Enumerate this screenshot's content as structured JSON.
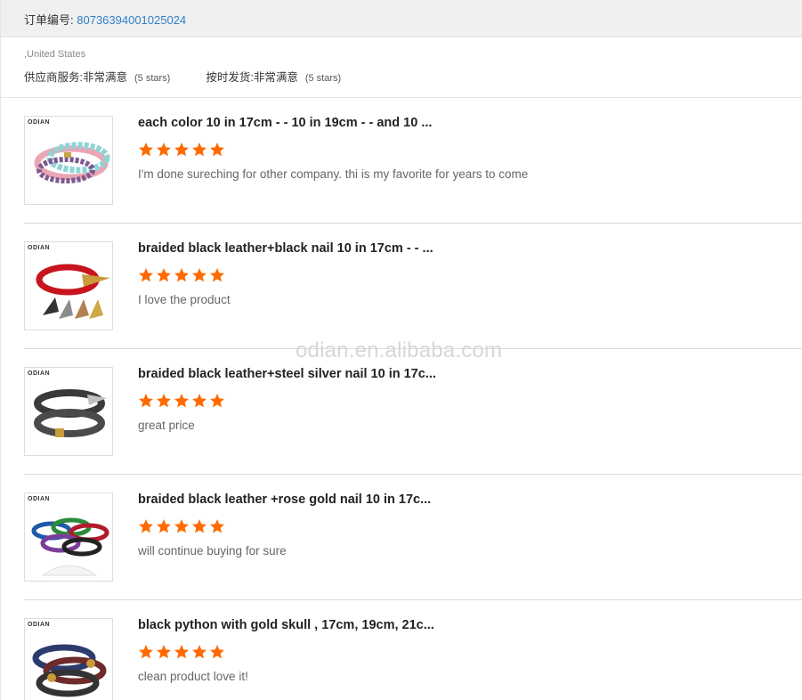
{
  "order": {
    "label": "订单编号:",
    "number": "80736394001025024"
  },
  "summary": {
    "country": ",United States",
    "supplier_service": {
      "label": "供应商服务:",
      "value": "非常满意",
      "stars": "(5 stars)"
    },
    "shipping": {
      "label": "按时发货:",
      "value": "非常满意",
      "stars": "(5 stars)"
    }
  },
  "items": [
    {
      "title": "each color 10 in 17cm - - 10 in 19cm - - and 10 ...",
      "rating": 5,
      "review": "I'm done sureching for other company. thi is my favorite for years to come",
      "brand": "ODIAN"
    },
    {
      "title": "braided black leather+black nail 10 in 17cm - - ...",
      "rating": 5,
      "review": "I love the product",
      "brand": "ODIAN"
    },
    {
      "title": "braided black leather+steel silver nail 10 in 17c...",
      "rating": 5,
      "review": "great price",
      "brand": "ODIAN"
    },
    {
      "title": "braided black leather +rose gold nail 10 in 17c...",
      "rating": 5,
      "review": "will continue buying for sure",
      "brand": "ODIAN"
    },
    {
      "title": "black python with gold skull , 17cm, 19cm, 21c...",
      "rating": 5,
      "review": "clean product love it!",
      "brand": "ODIAN"
    }
  ],
  "watermark": "odian.en.alibaba.com",
  "colors": {
    "star": "#ff6a00",
    "link": "#2f7fc7",
    "header_bg": "#f0f0f0"
  }
}
